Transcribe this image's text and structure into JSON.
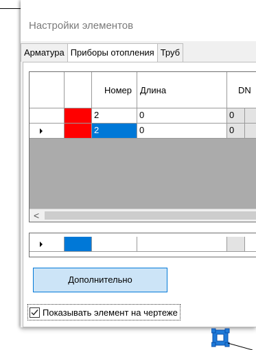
{
  "window": {
    "title": "Настройки элементов"
  },
  "tabs": [
    {
      "label": "Арматура"
    },
    {
      "label": "Приборы отопления"
    },
    {
      "label": "Труб"
    }
  ],
  "grid": {
    "columns": [
      "",
      "",
      "Номер",
      "Длина",
      "DN"
    ],
    "rows": [
      {
        "color": "#ff0000",
        "number": "2",
        "length": "0",
        "dn": "0",
        "current": false
      },
      {
        "color": "#ff0000",
        "number": "2",
        "length": "0",
        "dn": "0",
        "current": true
      }
    ],
    "scroll_left_glyph": "<"
  },
  "new_row": {
    "color": "#0078d7"
  },
  "buttons": {
    "more_label": "Дополнительно"
  },
  "checkbox": {
    "label": "Показывать элемент на чертеже",
    "checked": true
  },
  "colors": {
    "accent": "#0078d7",
    "element_red": "#ff0000"
  }
}
